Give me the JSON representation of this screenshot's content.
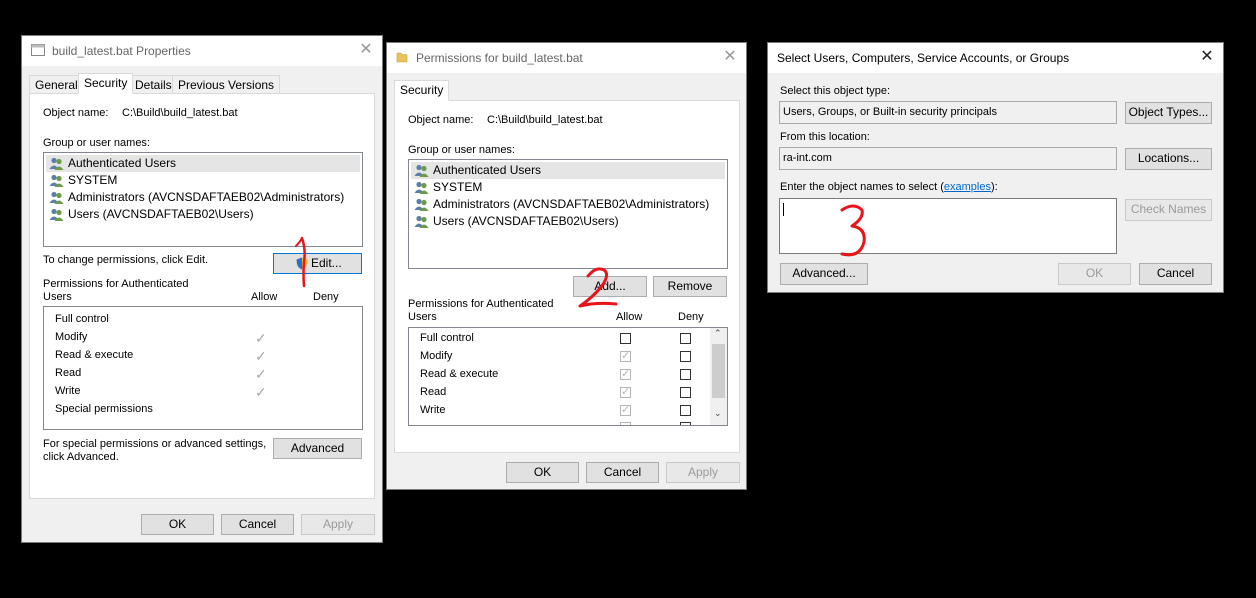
{
  "props": {
    "title": "build_latest.bat Properties",
    "tabs": [
      "General",
      "Security",
      "Details",
      "Previous Versions"
    ],
    "object_label": "Object name:",
    "object_value": "C:\\Build\\build_latest.bat",
    "group_label": "Group or user names:",
    "users": [
      "Authenticated Users",
      "SYSTEM",
      "Administrators (AVCNSDAFTAEB02\\Administrators)",
      "Users (AVCNSDAFTAEB02\\Users)"
    ],
    "change_text": "To change permissions, click Edit.",
    "edit_label": "Edit...",
    "perm_header_1": "Permissions for Authenticated",
    "perm_header_2": "Users",
    "allow": "Allow",
    "deny": "Deny",
    "permissions": [
      "Full control",
      "Modify",
      "Read & execute",
      "Read",
      "Write",
      "Special permissions"
    ],
    "adv_text_1": "For special permissions or advanced settings,",
    "adv_text_2": "click Advanced.",
    "advanced_label": "Advanced",
    "ok": "OK",
    "cancel": "Cancel",
    "apply": "Apply"
  },
  "perms": {
    "title": "Permissions for build_latest.bat",
    "tab": "Security",
    "object_label": "Object name:",
    "object_value": "C:\\Build\\build_latest.bat",
    "group_label": "Group or user names:",
    "users": [
      "Authenticated Users",
      "SYSTEM",
      "Administrators (AVCNSDAFTAEB02\\Administrators)",
      "Users (AVCNSDAFTAEB02\\Users)"
    ],
    "add_label": "Add...",
    "remove_label": "Remove",
    "perm_header_1": "Permissions for Authenticated",
    "perm_header_2": "Users",
    "allow": "Allow",
    "deny": "Deny",
    "permissions": [
      "Full control",
      "Modify",
      "Read & execute",
      "Read",
      "Write"
    ],
    "ok": "OK",
    "cancel": "Cancel",
    "apply": "Apply"
  },
  "select": {
    "title": "Select Users, Computers, Service Accounts, or Groups",
    "type_label": "Select this object type:",
    "type_value": "Users, Groups, or Built-in security principals",
    "object_types_label": "Object Types...",
    "location_label": "From this location:",
    "location_value": "ra-int.com",
    "locations_label": "Locations...",
    "enter_label": "Enter the object names to select (",
    "examples_link": "examples",
    "enter_label_end": "):",
    "names_value": "",
    "check_names_label": "Check Names",
    "advanced_label": "Advanced...",
    "ok": "OK",
    "cancel": "Cancel"
  },
  "annotations": {
    "step1": "1",
    "step2": "2",
    "step3": "3",
    "color": "#e8141a"
  }
}
